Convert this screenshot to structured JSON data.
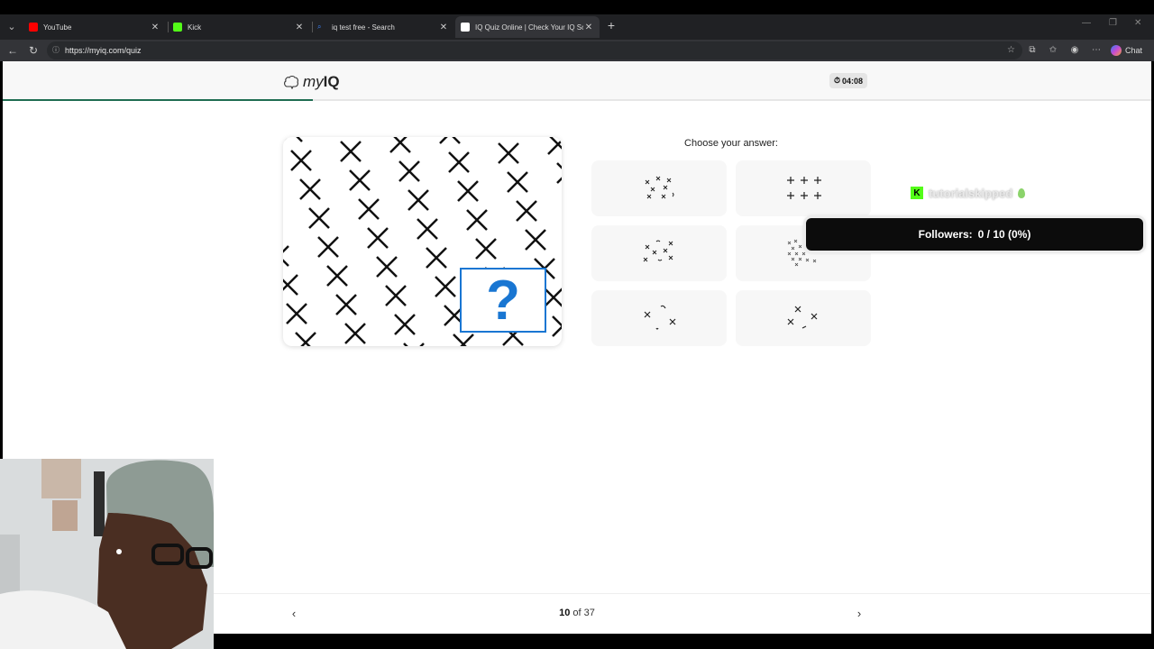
{
  "browser": {
    "tabs": [
      {
        "title": "YouTube",
        "favicon_color": "#ff0000",
        "active": false
      },
      {
        "title": "Kick",
        "favicon_color": "#53fc18",
        "active": false
      },
      {
        "title": "iq test free - Search",
        "favicon_color": "#3b82f6",
        "active": false
      },
      {
        "title": "IQ Quiz Online | Check Your IQ Sc",
        "favicon_color": "#ffffff",
        "active": true
      }
    ],
    "url": "https://myiq.com/quiz",
    "chat_label": "Chat"
  },
  "quiz": {
    "brand_prefix": "my",
    "brand_suffix": "IQ",
    "timer": "04:08",
    "progress": 0.27,
    "question_mark": "?",
    "choose_label": "Choose your answer:",
    "options": [
      {
        "pattern": "scattered-crosses-rotated"
      },
      {
        "pattern": "plus-grid-3x2"
      },
      {
        "pattern": "scattered-crosses-ring"
      },
      {
        "pattern": "small-crosses-cluster"
      },
      {
        "pattern": "three-crosses-arc"
      },
      {
        "pattern": "three-crosses-diamond"
      }
    ],
    "pager": {
      "current": "10",
      "of_word": "of",
      "total": "37"
    }
  },
  "overlay": {
    "kick_name": "tutorialskipped",
    "followers_label": "Followers:",
    "followers_value": "0 / 10 (0%)"
  },
  "colors": {
    "accent": "#1976d2",
    "progress": "#1f6d52",
    "kick_green": "#53fc18"
  }
}
